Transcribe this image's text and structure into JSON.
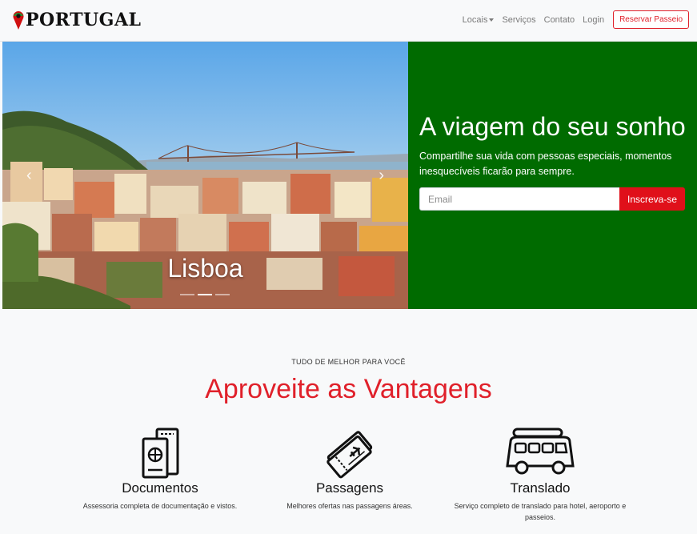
{
  "brand": {
    "name": "PORTUGAL",
    "pin_colors": {
      "top": "#2e8b2e",
      "bottom": "#d01010",
      "center": "#111111"
    }
  },
  "nav": {
    "items": [
      {
        "label": "Locais",
        "dropdown": true
      },
      {
        "label": "Serviços"
      },
      {
        "label": "Contato"
      },
      {
        "label": "Login"
      }
    ],
    "cta_label": "Reservar Passeio"
  },
  "carousel": {
    "caption": "Lisboa",
    "slide_count": 3,
    "active_slide": 2,
    "prev_icon": "chevron-left-icon",
    "next_icon": "chevron-right-icon"
  },
  "promo": {
    "title": "A viagem do seu sonho",
    "text": "Compartilhe sua vida com pessoas especiais, momentos inesquecíveis ficarão para sempre.",
    "email_placeholder": "Email",
    "button_label": "Inscreva-se",
    "background": "#006b00",
    "button_color": "#e0101a"
  },
  "features": {
    "eyebrow": "TUDO DE MELHOR PARA VOCÊ",
    "title": "Aproveite as Vantagens",
    "title_color": "#e0202a",
    "items": [
      {
        "title": "Documentos",
        "text": "Assessoria completa de documentação e vistos.",
        "icon": "passport-icon"
      },
      {
        "title": "Passagens",
        "text": "Melhores ofertas nas passagens áreas.",
        "icon": "plane-ticket-icon"
      },
      {
        "title": "Translado",
        "text": "Serviço completo de translado para hotel, aeroporto e passeios.",
        "icon": "van-icon"
      }
    ]
  }
}
